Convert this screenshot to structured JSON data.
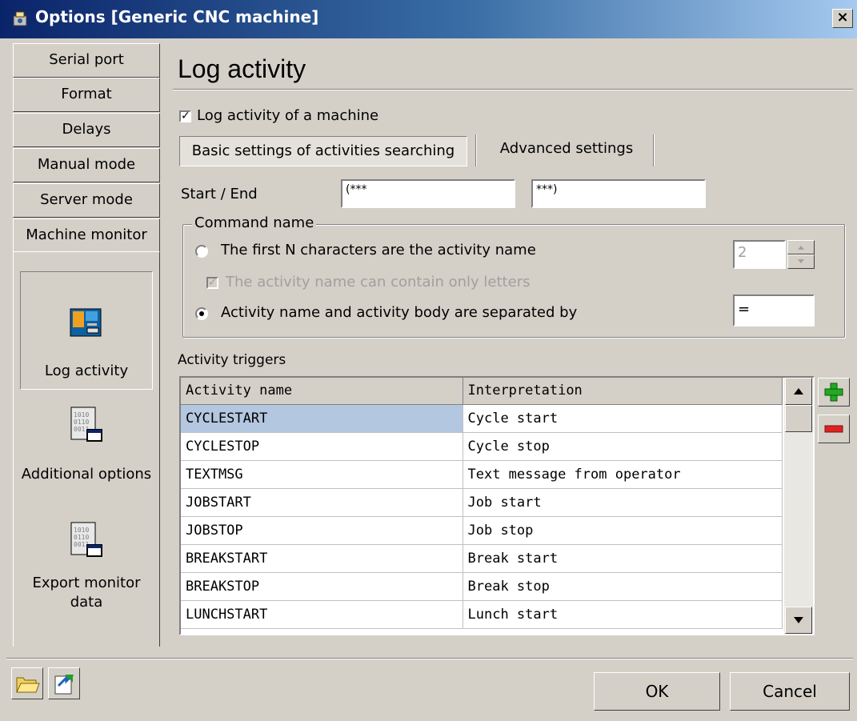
{
  "window": {
    "title": "Options [Generic CNC machine]",
    "close_symbol": "×"
  },
  "nav": {
    "buttons": [
      "Serial port",
      "Format",
      "Delays",
      "Manual mode",
      "Server mode",
      "Machine monitor"
    ],
    "items": [
      {
        "label": "Log activity",
        "icon": "log-activity-icon",
        "selected": true
      },
      {
        "label": "Additional options",
        "icon": "binary-document-icon",
        "selected": false
      },
      {
        "label": "Export monitor data",
        "icon": "binary-document-icon",
        "selected": false
      }
    ]
  },
  "main": {
    "heading": "Log activity",
    "log_checkbox": {
      "label": "Log activity of a machine",
      "checked": true
    },
    "tabs": [
      "Basic settings of activities searching",
      "Advanced settings"
    ],
    "start_end": {
      "label": "Start / End",
      "start_value": "(***",
      "end_value": "***)"
    },
    "command_name": {
      "title": "Command name",
      "option1": "The first N characters are the activity name",
      "option1_value": "2",
      "sub_checkbox": "The activity name can contain only letters",
      "option2": "Activity name and activity body are separated by",
      "option2_value": "="
    },
    "triggers": {
      "label": "Activity triggers",
      "columns": [
        "Activity name",
        "Interpretation"
      ],
      "rows": [
        [
          "CYCLESTART",
          "Cycle start"
        ],
        [
          "CYCLESTOP",
          "Cycle stop"
        ],
        [
          "TEXTMSG",
          "Text message from operator"
        ],
        [
          "JOBSTART",
          "Job start"
        ],
        [
          "JOBSTOP",
          "Job stop"
        ],
        [
          "BREAKSTART",
          "Break start"
        ],
        [
          "BREAKSTOP",
          "Break stop"
        ],
        [
          "LUNCHSTART",
          "Lunch start"
        ]
      ]
    }
  },
  "footer": {
    "ok": "OK",
    "cancel": "Cancel"
  },
  "colors": {
    "face": "#d4d0c8",
    "selection": "#b3c7e0",
    "title_start": "#0a246a",
    "add_green": "#22aa22",
    "remove_red": "#dd2222"
  }
}
